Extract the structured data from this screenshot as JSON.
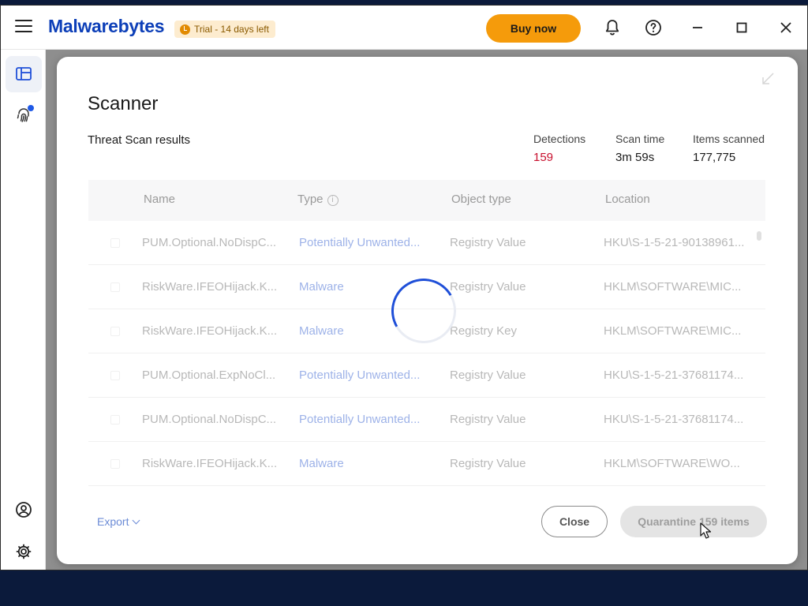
{
  "app": {
    "logo_text": "Malwarebytes",
    "trial_badge": "Trial - 14 days left",
    "buy_button": "Buy now",
    "icons": [
      "menu-icon",
      "bell-icon",
      "help-icon",
      "minimize-icon",
      "maximize-icon",
      "close-icon"
    ]
  },
  "sidebar": {
    "items": [
      {
        "name": "dashboard",
        "icon": "dashboard-icon",
        "active": true
      },
      {
        "name": "detection",
        "icon": "fingerprint-icon",
        "badge": true
      },
      {
        "name": "account",
        "icon": "account-icon"
      },
      {
        "name": "settings",
        "icon": "gear-icon"
      }
    ]
  },
  "modal": {
    "title": "Scanner",
    "subtitle": "Threat Scan results",
    "stats": {
      "detections_label": "Detections",
      "detections_value": "159",
      "scan_time_label": "Scan time",
      "scan_time_value": "3m 59s",
      "items_scanned_label": "Items scanned",
      "items_scanned_value": "177,775"
    },
    "table": {
      "headers": {
        "name": "Name",
        "type": "Type",
        "object_type": "Object type",
        "location": "Location"
      },
      "rows": [
        {
          "name": "PUM.Optional.NoDispC...",
          "type": "Potentially Unwanted...",
          "object_type": "Registry Value",
          "location": "HKU\\S-1-5-21-90138961..."
        },
        {
          "name": "RiskWare.IFEOHijack.K...",
          "type": "Malware",
          "object_type": "Registry Value",
          "location": "HKLM\\SOFTWARE\\MIC..."
        },
        {
          "name": "RiskWare.IFEOHijack.K...",
          "type": "Malware",
          "object_type": "Registry Key",
          "location": "HKLM\\SOFTWARE\\MIC..."
        },
        {
          "name": "PUM.Optional.ExpNoCl...",
          "type": "Potentially Unwanted...",
          "object_type": "Registry Value",
          "location": "HKU\\S-1-5-21-37681174..."
        },
        {
          "name": "PUM.Optional.NoDispC...",
          "type": "Potentially Unwanted...",
          "object_type": "Registry Value",
          "location": "HKU\\S-1-5-21-37681174..."
        },
        {
          "name": "RiskWare.IFEOHijack.K...",
          "type": "Malware",
          "object_type": "Registry Value",
          "location": "HKLM\\SOFTWARE\\WO..."
        }
      ]
    },
    "export_label": "Export",
    "close_button": "Close",
    "quarantine_button": "Quarantine 159 items"
  },
  "colors": {
    "brand": "#0d3fb8",
    "accent": "#f59b0b",
    "detections": "#c8102e"
  }
}
